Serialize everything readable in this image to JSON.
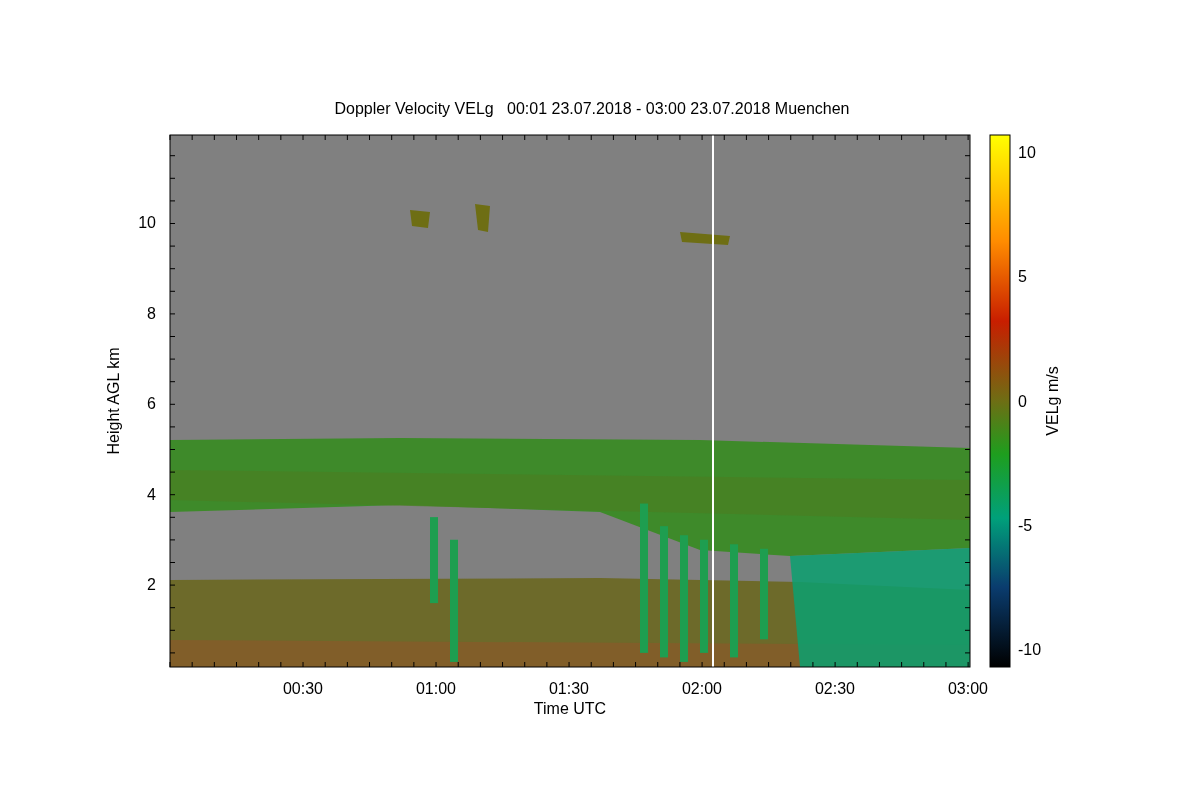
{
  "title": "Doppler Velocity VELg   00:01 23.07.2018 - 03:00 23.07.2018 Muenchen",
  "plot": {
    "ylabel": "Height AGL km",
    "xlabel": "Time UTC",
    "yticks": [
      "10",
      "8",
      "6",
      "4",
      "2"
    ],
    "xticks": [
      "00:30",
      "01:00",
      "01:30",
      "02:00",
      "02:30",
      "03:00"
    ]
  },
  "colorbar": {
    "label": "VELg m/s",
    "ticks": [
      "10",
      "5",
      "0",
      "-5",
      "-10"
    ]
  }
}
